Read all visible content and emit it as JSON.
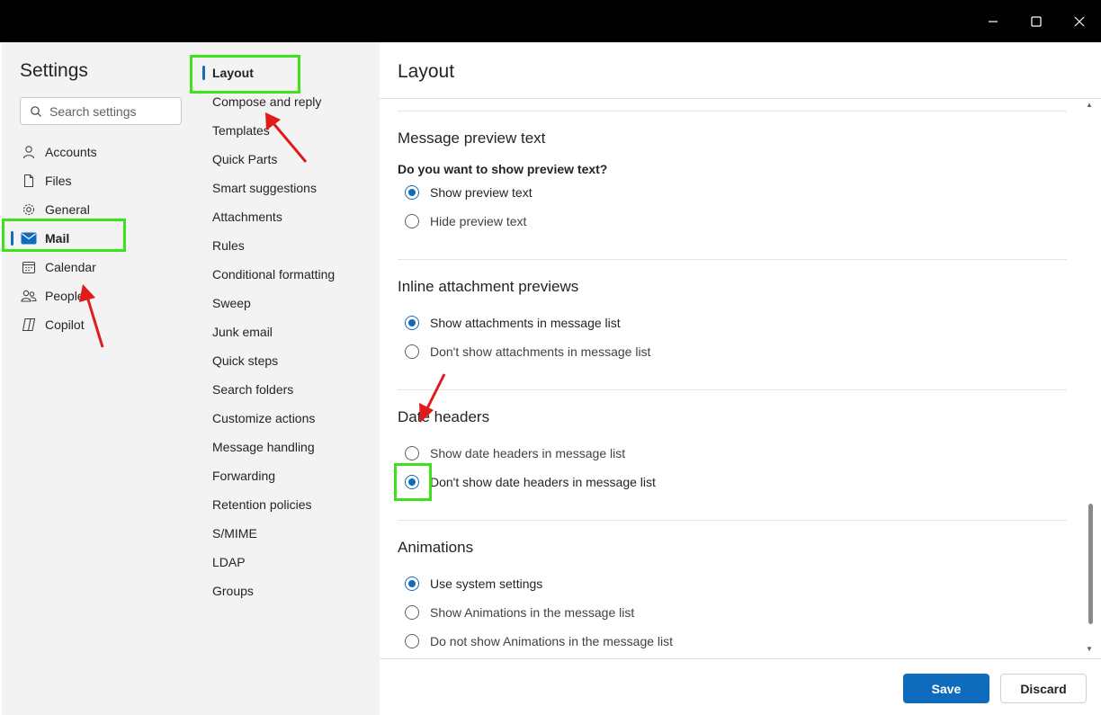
{
  "window": {
    "minimize_glyph": "—",
    "maximize_glyph": "☐",
    "close_glyph": "✕"
  },
  "sidebar": {
    "title": "Settings",
    "search_placeholder": "Search settings",
    "items": [
      {
        "label": "Accounts",
        "icon": "person-icon"
      },
      {
        "label": "Files",
        "icon": "file-icon"
      },
      {
        "label": "General",
        "icon": "gear-icon"
      },
      {
        "label": "Mail",
        "icon": "mail-icon",
        "selected": true
      },
      {
        "label": "Calendar",
        "icon": "calendar-icon"
      },
      {
        "label": "People",
        "icon": "people-icon"
      },
      {
        "label": "Copilot",
        "icon": "copilot-icon"
      }
    ]
  },
  "subnav": {
    "items": [
      {
        "label": "Layout",
        "selected": true
      },
      {
        "label": "Compose and reply"
      },
      {
        "label": "Templates"
      },
      {
        "label": "Quick Parts"
      },
      {
        "label": "Smart suggestions"
      },
      {
        "label": "Attachments"
      },
      {
        "label": "Rules"
      },
      {
        "label": "Conditional formatting"
      },
      {
        "label": "Sweep"
      },
      {
        "label": "Junk email"
      },
      {
        "label": "Quick steps"
      },
      {
        "label": "Search folders"
      },
      {
        "label": "Customize actions"
      },
      {
        "label": "Message handling"
      },
      {
        "label": "Forwarding"
      },
      {
        "label": "Retention policies"
      },
      {
        "label": "S/MIME"
      },
      {
        "label": "LDAP"
      },
      {
        "label": "Groups"
      }
    ]
  },
  "content": {
    "title": "Layout",
    "sections": [
      {
        "title": "Message preview text",
        "question": "Do you want to show preview text?",
        "options": [
          {
            "label": "Show preview text",
            "selected": true
          },
          {
            "label": "Hide preview text",
            "selected": false
          }
        ]
      },
      {
        "title": "Inline attachment previews",
        "options": [
          {
            "label": "Show attachments in message list",
            "selected": true
          },
          {
            "label": "Don't show attachments in message list",
            "selected": false
          }
        ]
      },
      {
        "title": "Date headers",
        "options": [
          {
            "label": "Show date headers in message list",
            "selected": false
          },
          {
            "label": "Don't show date headers in message list",
            "selected": true
          }
        ]
      },
      {
        "title": "Animations",
        "options": [
          {
            "label": "Use system settings",
            "selected": true
          },
          {
            "label": "Show Animations in the message list",
            "selected": false
          },
          {
            "label": "Do not show Animations in the message list",
            "selected": false
          }
        ]
      }
    ]
  },
  "footer": {
    "save_label": "Save",
    "discard_label": "Discard"
  },
  "colors": {
    "accent": "#0f6cbd",
    "highlight_box": "#3ee21a",
    "annotation_arrow": "#e01b1b"
  }
}
